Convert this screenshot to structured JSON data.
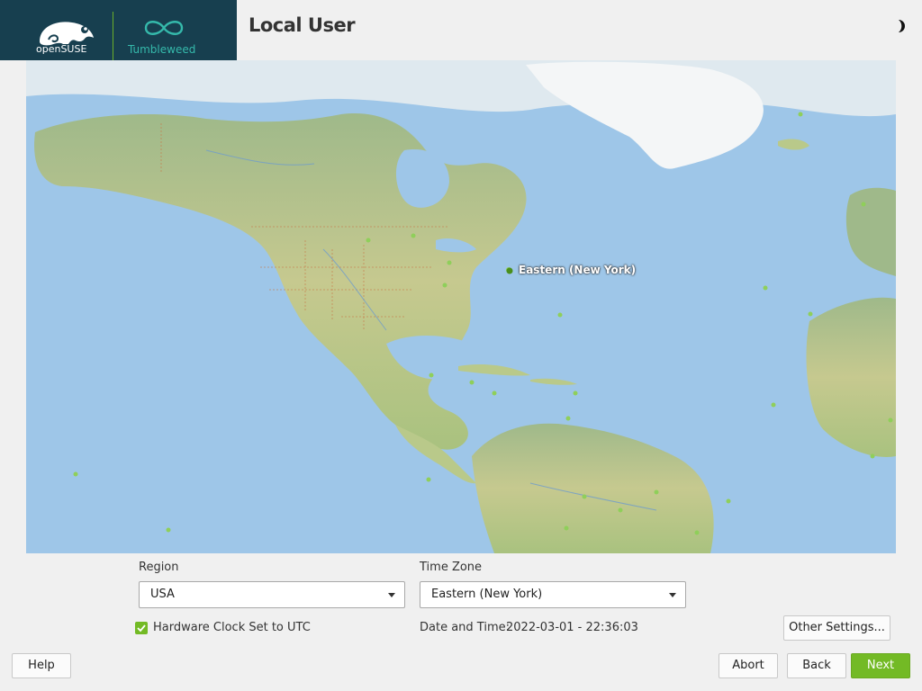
{
  "header": {
    "brand": "openSUSE",
    "product": "Tumbleweed",
    "title": "Local User",
    "theme_icon": "half-moon-icon"
  },
  "map": {
    "selected_label": "Eastern (New York)",
    "colors": {
      "ocean": "#9ec6e8",
      "land": "#b9c98a",
      "ice": "#eef2f4",
      "marker": "#8fcf5a"
    }
  },
  "region": {
    "label": "Region",
    "value": "USA"
  },
  "timezone": {
    "label": "Time Zone",
    "value": "Eastern (New York)"
  },
  "hw_clock": {
    "label": "Hardware Clock Set to UTC",
    "checked": true
  },
  "datetime": {
    "label": "Date and Time:",
    "value": "2022-03-01 - 22:36:03"
  },
  "buttons": {
    "other_settings": "Other Settings...",
    "help": "Help",
    "abort": "Abort",
    "back": "Back",
    "next": "Next"
  },
  "colors": {
    "brand_dark": "#173f4f",
    "accent": "#73ba25",
    "teal": "#35b9ab"
  }
}
